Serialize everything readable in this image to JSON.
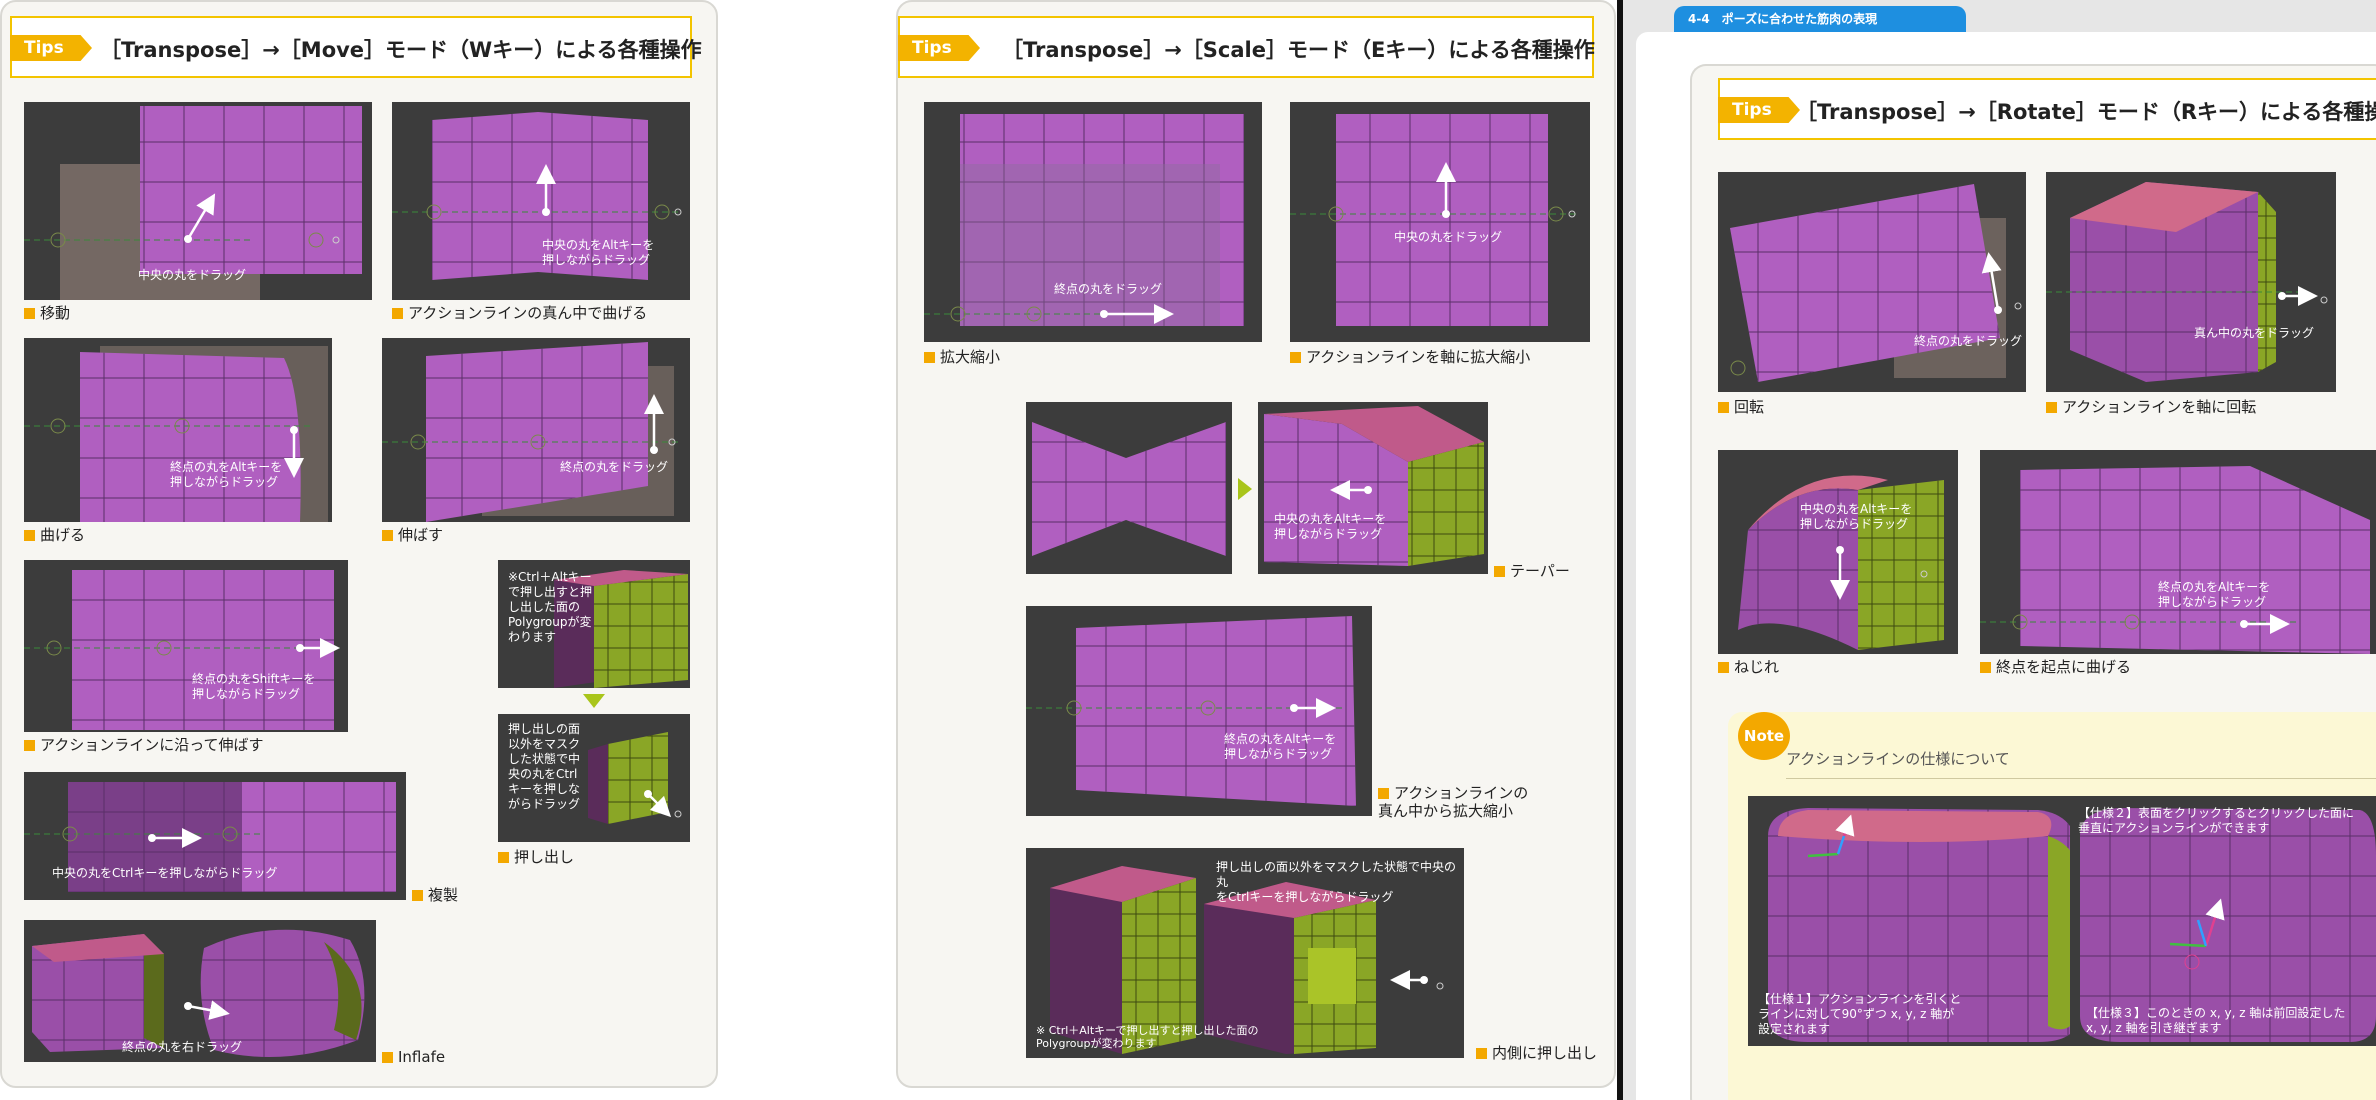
{
  "tips_label": "Tips",
  "move": {
    "title": "［Transpose］→［Move］モード（Wキー）による各種操作",
    "items": [
      {
        "caption": "移動",
        "text": "中央の丸をドラッグ"
      },
      {
        "caption": "アクションラインの真ん中で曲げる",
        "text": "中央の丸をAltキーを\n押しながらドラッグ"
      },
      {
        "caption": "曲げる",
        "text": "終点の丸をAltキーを\n押しながらドラッグ"
      },
      {
        "caption": "伸ばす",
        "text": "終点の丸をドラッグ"
      },
      {
        "caption": "アクションラインに沿って伸ばす",
        "text": "終点の丸をShiftキーを\n押しながらドラッグ"
      },
      {
        "caption": "複製",
        "text": "中央の丸をCtrlキーを押しながらドラッグ"
      },
      {
        "caption": "Inflafe",
        "text": "終点の丸を右ドラッグ"
      }
    ],
    "extrude_note1": "※Ctrl＋Altキー\nで押し出すと押\nし出した面の\nPolygroupが変\nわります",
    "extrude_note2": "押し出しの面\n以外をマスク\nした状態で中\n央の丸をCtrl\nキーを押しな\nがらドラッグ",
    "extrude_caption": "押し出し"
  },
  "scale": {
    "title": "［Transpose］→［Scale］モード（Eキー）による各種操作",
    "items": [
      {
        "caption": "拡大縮小",
        "text": "終点の丸をドラッグ"
      },
      {
        "caption": "アクションラインを軸に拡大縮小",
        "text": "中央の丸をドラッグ"
      },
      {
        "caption": "テーパー",
        "text": "中央の丸をAltキーを\n押しながらドラッグ"
      },
      {
        "caption": "アクションラインの\n真ん中から拡大縮小",
        "text": "終点の丸をAltキーを\n押しながらドラッグ"
      },
      {
        "caption": "内側に押し出し",
        "text": "押し出しの面以外をマスクした状態で中央の丸\nをCtrlキーを押しながらドラッグ"
      }
    ],
    "inner_note": "※ Ctrl＋Altキーで押し出すと押し出した面の\nPolygroupが変わります"
  },
  "section_tab": "4-4　ポーズに合わせた筋肉の表現",
  "rotate": {
    "title": "［Transpose］→［Rotate］モード（Rキー）による各種操作",
    "items": [
      {
        "caption": "回転",
        "text": "終点の丸をドラッグ"
      },
      {
        "caption": "アクションラインを軸に回転",
        "text": "真ん中の丸をドラッグ"
      },
      {
        "caption": "ねじれ",
        "text": "中央の丸をAltキーを\n押しながらドラッグ"
      },
      {
        "caption": "終点を起点に曲げる",
        "text": "終点の丸をAltキーを\n押しながらドラッグ"
      }
    ]
  },
  "note": {
    "badge": "Note",
    "title": "アクションラインの仕様について",
    "spec1": "【仕様１】アクションラインを引くと\nラインに対して90°ずつ x, y, z 軸が\n設定されます",
    "spec2": "【仕様２】表面をクリックするとクリックした面に\n垂直にアクションラインができます",
    "spec3": "【仕様３】このときの x, y, z 軸は前回設定した\nx, y, z 軸を引き継ぎます"
  }
}
